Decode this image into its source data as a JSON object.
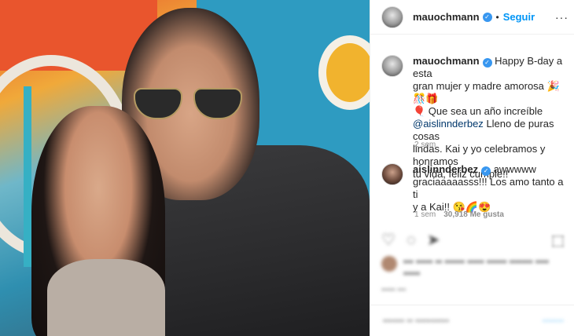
{
  "header": {
    "username": "mauochmann",
    "separator": "•",
    "follow_label": "Seguir",
    "more_label": "···"
  },
  "caption": {
    "username": "mauochmann",
    "text_line1": "Happy B-day a esta",
    "text_line2": "gran mujer y madre amorosa 🎉🎊🎁",
    "text_line3": "🎈 Que sea un año increíble",
    "mention": "@aislinnderbez",
    "text_line4": "Lleno de puras cosas",
    "text_line5": "lindas. Kai y yo celebramos y honramos",
    "text_line6": "tu vida, feliz cumple!!",
    "time": "2 sem"
  },
  "reply": {
    "username": "aislinnderbez",
    "text_line1": "awwwww",
    "text_line2": "graciaaaaasss!!! Los amo tanto a ti",
    "text_line3": "y a Kai!! 😘🌈😍",
    "time": "1 sem",
    "likes": "30,918 Me gusta"
  },
  "actions": {
    "icons": [
      "heart-icon",
      "comment-icon",
      "share-icon",
      "bookmark-icon"
    ]
  },
  "colors": {
    "link": "#0095f6",
    "verified": "#3897f0",
    "muted": "#8e8e8e"
  }
}
